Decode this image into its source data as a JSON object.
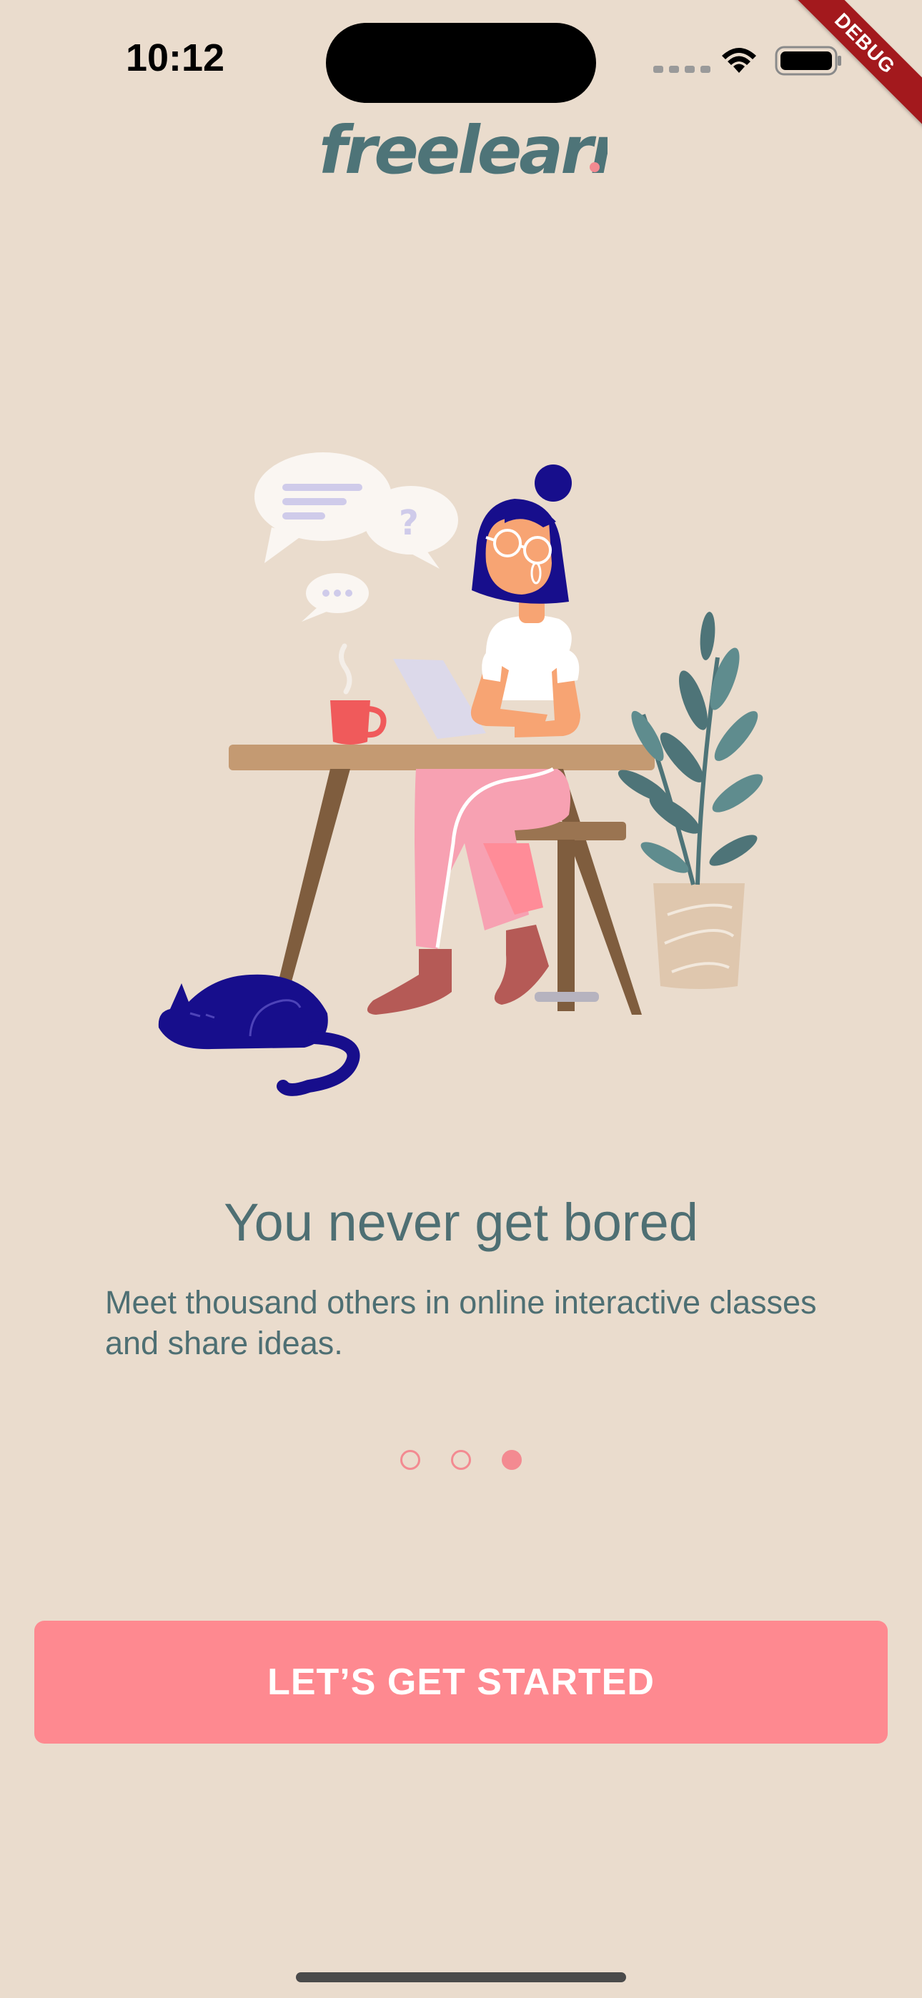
{
  "status_bar": {
    "time": "10:12"
  },
  "debug_banner": "DEBUG",
  "brand": {
    "logo_text": "freelearn",
    "logo_dot_color": "#F38A91",
    "logo_color": "#4E7478"
  },
  "onboarding": {
    "title": "You never get bored",
    "description": "Meet thousand others in online interactive classes and share ideas.",
    "pages_total": 3,
    "current_page": 3
  },
  "cta": {
    "label": "LET’S GET STARTED"
  },
  "colors": {
    "background": "#EADCCD",
    "text": "#4E6F73",
    "accent": "#FE8990"
  }
}
